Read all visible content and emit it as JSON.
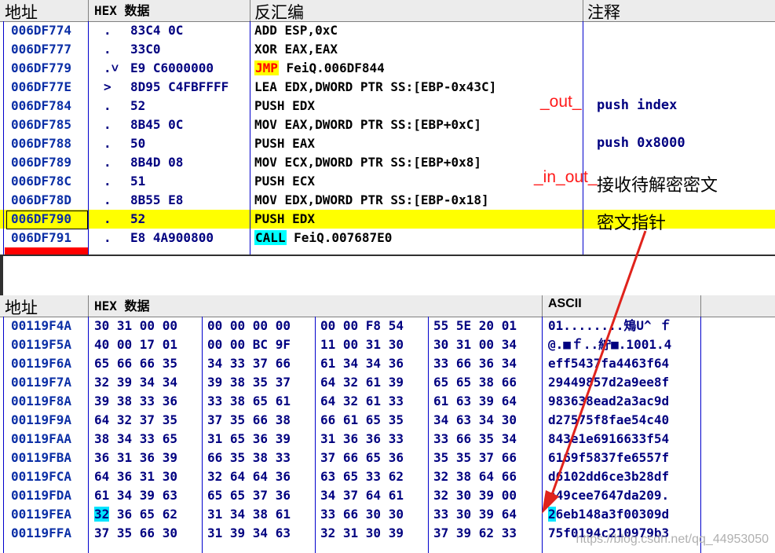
{
  "disasm": {
    "headers": {
      "addr": "地址",
      "hex": "HEX 数据",
      "disasm": "反汇编",
      "comment": "注释"
    },
    "rows": [
      {
        "addr": "006DF774",
        "mark": ".",
        "hex": "83C4 0C",
        "op": "ADD ESP,0xC"
      },
      {
        "addr": "006DF777",
        "mark": ".",
        "hex": "33C0",
        "op": "XOR EAX,EAX"
      },
      {
        "addr": "006DF779",
        "mark": ".˅",
        "hex": "E9 C6000000",
        "tag": "JMP",
        "op": " FeiQ.006DF844"
      },
      {
        "addr": "006DF77E",
        "mark": ">",
        "hex": "8D95 C4FBFFFF",
        "op": "LEA EDX,DWORD PTR SS:[EBP-0x43C]"
      },
      {
        "addr": "006DF784",
        "mark": ".",
        "hex": "52",
        "op": "PUSH EDX"
      },
      {
        "addr": "006DF785",
        "mark": ".",
        "hex": "8B45 0C",
        "op": "MOV EAX,DWORD PTR SS:[EBP+0xC]"
      },
      {
        "addr": "006DF788",
        "mark": ".",
        "hex": "50",
        "op": "PUSH EAX"
      },
      {
        "addr": "006DF789",
        "mark": ".",
        "hex": "8B4D 08",
        "op": "MOV ECX,DWORD PTR SS:[EBP+0x8]"
      },
      {
        "addr": "006DF78C",
        "mark": ".",
        "hex": "51",
        "op": "PUSH ECX"
      },
      {
        "addr": "006DF78D",
        "mark": ".",
        "hex": "8B55 E8",
        "op": "MOV EDX,DWORD PTR SS:[EBP-0x18]"
      },
      {
        "addr": "006DF790",
        "mark": ".",
        "hex": "52",
        "op": "PUSH EDX"
      },
      {
        "addr": "006DF791",
        "mark": ".",
        "hex": "E8 4A900800",
        "tag": "CALL",
        "op": " FeiQ.007687E0"
      }
    ],
    "comments": {
      "push_index": "push index",
      "push_0x8000": "push 0x8000"
    },
    "annotations": {
      "out": "_out_",
      "in_out": "_in_out_",
      "recv": "接收待解密密文",
      "ptr": "密文指针"
    }
  },
  "dump": {
    "headers": {
      "addr": "地址",
      "hex": "HEX 数据",
      "ascii": "ASCII"
    },
    "rows": [
      {
        "addr": "00119F4A",
        "b1": "30 31 00 00",
        "b2": "00 00 00 00",
        "b3": "00 00 F8 54",
        "b4": "55 5E 20 01",
        "ascii": "01........鴙U^ ｆ"
      },
      {
        "addr": "00119F5A",
        "b1": "40 00 17 01",
        "b2": "00 00 BC 9F",
        "b3": "11 00 31 30",
        "b4": "30 31 00 34",
        "ascii": "@.■ｆ..紵■.1001.4"
      },
      {
        "addr": "00119F6A",
        "b1": "65 66 66 35",
        "b2": "34 33 37 66",
        "b3": "61 34 34 36",
        "b4": "33 66 36 34",
        "ascii": "eff5437fa4463f64"
      },
      {
        "addr": "00119F7A",
        "b1": "32 39 34 34",
        "b2": "39 38 35 37",
        "b3": "64 32 61 39",
        "b4": "65 65 38 66",
        "ascii": "29449857d2a9ee8f"
      },
      {
        "addr": "00119F8A",
        "b1": "39 38 33 36",
        "b2": "33 38 65 61",
        "b3": "64 32 61 33",
        "b4": "61 63 39 64",
        "ascii": "983638ead2a3ac9d"
      },
      {
        "addr": "00119F9A",
        "b1": "64 32 37 35",
        "b2": "37 35 66 38",
        "b3": "66 61 65 35",
        "b4": "34 63 34 30",
        "ascii": "d27575f8fae54c40"
      },
      {
        "addr": "00119FAA",
        "b1": "38 34 33 65",
        "b2": "31 65 36 39",
        "b3": "31 36 36 33",
        "b4": "33 66 35 34",
        "ascii": "843e1e6916633f54"
      },
      {
        "addr": "00119FBA",
        "b1": "36 31 36 39",
        "b2": "66 35 38 33",
        "b3": "37 66 65 36",
        "b4": "35 35 37 66",
        "ascii": "6169f5837fe6557f"
      },
      {
        "addr": "00119FCA",
        "b1": "64 36 31 30",
        "b2": "32 64 64 36",
        "b3": "63 65 33 62",
        "b4": "32 38 64 66",
        "ascii": "d6102dd6ce3b28df"
      },
      {
        "addr": "00119FDA",
        "b1": "61 34 39 63",
        "b2": "65 65 37 36",
        "b3": "34 37 64 61",
        "b4": "32 30 39 00",
        "ascii": "a49cee7647da209."
      },
      {
        "addr": "00119FEA",
        "b1": "32 36 65 62",
        "b2": "31 34 38 61",
        "b3": "33 66 30 30",
        "b4": "33 30 39 64",
        "ascii": "26eb148a3f00309d",
        "sel": true
      },
      {
        "addr": "00119FFA",
        "b1": "37 35 66 30",
        "b2": "31 39 34 63",
        "b3": "32 31 30 39",
        "b4": "37 39 62 33",
        "ascii": "75f0194c210979b3"
      }
    ]
  },
  "watermark": "https://blog.csdn.net/qq_44953050"
}
